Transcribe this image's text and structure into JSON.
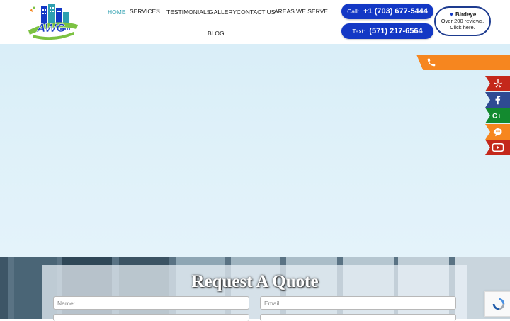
{
  "nav": {
    "items": [
      {
        "label": "HOME",
        "active": true
      },
      {
        "label": "SERVICES",
        "has_dropdown": true
      },
      {
        "label": "TESTIMONIALS"
      },
      {
        "label": "GALLERY"
      },
      {
        "label": "CONTACT US"
      },
      {
        "label": "AREAS WE SERVE",
        "has_dropdown": true
      },
      {
        "label": "BLOG"
      }
    ]
  },
  "contact": {
    "call_label": "Call:",
    "call_number": "+1 (703) 677-5444",
    "text_label": "Text:",
    "text_number": "(571) 217-6564"
  },
  "birdeye": {
    "brand": "Birdeye",
    "line1": "Over 200 reviews.",
    "line2": "Click here."
  },
  "side_widgets": [
    {
      "icon": "phone-icon",
      "color": "#f6861f"
    },
    {
      "icon": "yelp-icon",
      "color": "#c4281b"
    },
    {
      "icon": "facebook-icon",
      "color": "#2f4b93"
    },
    {
      "icon": "google-plus-icon",
      "color": "#138a2f"
    },
    {
      "icon": "angi-icon",
      "color": "#f6861f"
    },
    {
      "icon": "youtube-icon",
      "color": "#c4281b"
    }
  ],
  "quote": {
    "title": "Request A Quote",
    "name_placeholder": "Name:",
    "email_placeholder": "Email:"
  },
  "colors": {
    "accent": "#2e9fb0",
    "pill_blue": "#1338c5",
    "orange": "#f6861f"
  }
}
